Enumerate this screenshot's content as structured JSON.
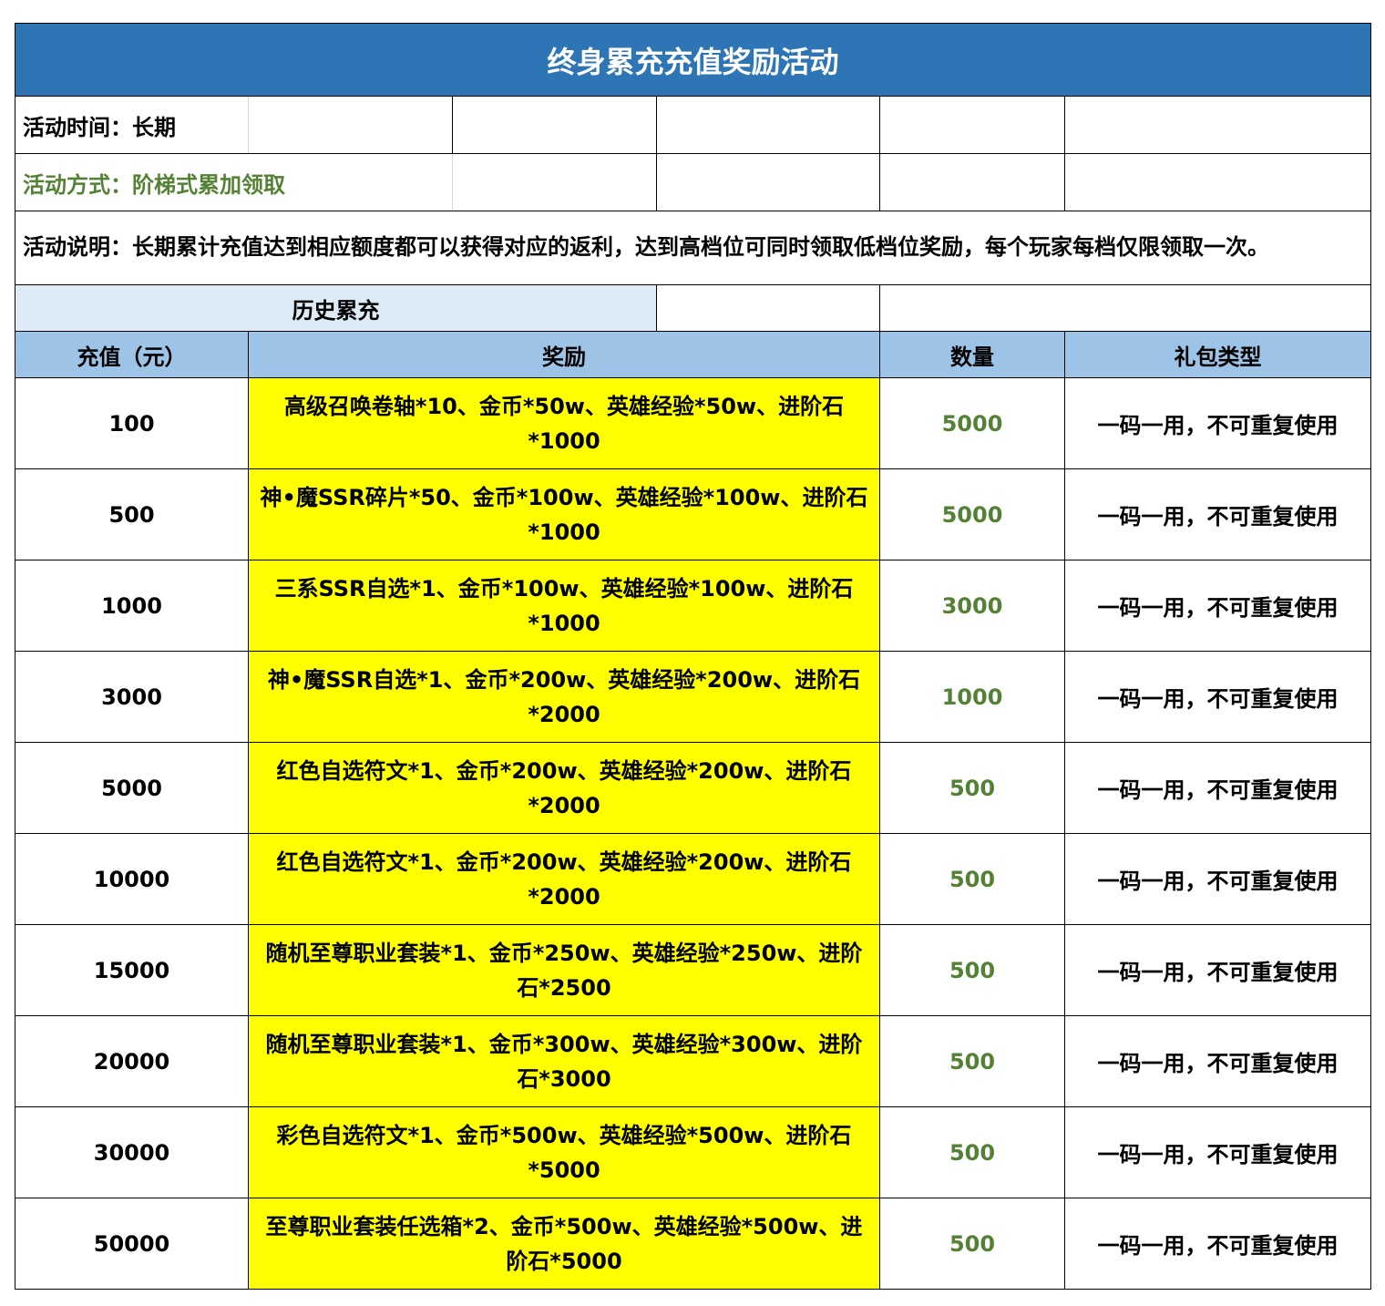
{
  "title": "终身累充充值奖励活动",
  "activity_time": "活动时间：长期",
  "activity_method": "活动方式：阶梯式累加领取",
  "activity_description": "活动说明：长期累计充值达到相应额度都可以获得对应的返利，达到高档位可同时领取低档位奖励，每个玩家每档仅限领取一次。",
  "section_header": "历史累充",
  "columns": {
    "recharge": "充值（元）",
    "reward": "奖励",
    "quantity": "数量",
    "gift_type": "礼包类型"
  },
  "colors": {
    "title_bg": "#2e75b6",
    "section_bg": "#ddebf7",
    "header_bg": "#9dc3e6",
    "reward_bg": "#ffff00",
    "quantity_text": "#548235"
  },
  "rows": [
    {
      "recharge": "100",
      "reward": "高级召唤卷轴*10、金币*50w、英雄经验*50w、进阶石*1000",
      "quantity": "5000",
      "gift_type": "一码一用，不可重复使用"
    },
    {
      "recharge": "500",
      "reward": "神•魔SSR碎片*50、金币*100w、英雄经验*100w、进阶石*1000",
      "quantity": "5000",
      "gift_type": "一码一用，不可重复使用"
    },
    {
      "recharge": "1000",
      "reward": "三系SSR自选*1、金币*100w、英雄经验*100w、进阶石*1000",
      "quantity": "3000",
      "gift_type": "一码一用，不可重复使用"
    },
    {
      "recharge": "3000",
      "reward": "神•魔SSR自选*1、金币*200w、英雄经验*200w、进阶石*2000",
      "quantity": "1000",
      "gift_type": "一码一用，不可重复使用"
    },
    {
      "recharge": "5000",
      "reward": "红色自选符文*1、金币*200w、英雄经验*200w、进阶石*2000",
      "quantity": "500",
      "gift_type": "一码一用，不可重复使用"
    },
    {
      "recharge": "10000",
      "reward": "红色自选符文*1、金币*200w、英雄经验*200w、进阶石*2000",
      "quantity": "500",
      "gift_type": "一码一用，不可重复使用"
    },
    {
      "recharge": "15000",
      "reward": "随机至尊职业套装*1、金币*250w、英雄经验*250w、进阶石*2500",
      "quantity": "500",
      "gift_type": "一码一用，不可重复使用"
    },
    {
      "recharge": "20000",
      "reward": "随机至尊职业套装*1、金币*300w、英雄经验*300w、进阶石*3000",
      "quantity": "500",
      "gift_type": "一码一用，不可重复使用"
    },
    {
      "recharge": "30000",
      "reward": "彩色自选符文*1、金币*500w、英雄经验*500w、进阶石*5000",
      "quantity": "500",
      "gift_type": "一码一用，不可重复使用"
    },
    {
      "recharge": "50000",
      "reward": "至尊职业套装任选箱*2、金币*500w、英雄经验*500w、进阶石*5000",
      "quantity": "500",
      "gift_type": "一码一用，不可重复使用"
    }
  ]
}
